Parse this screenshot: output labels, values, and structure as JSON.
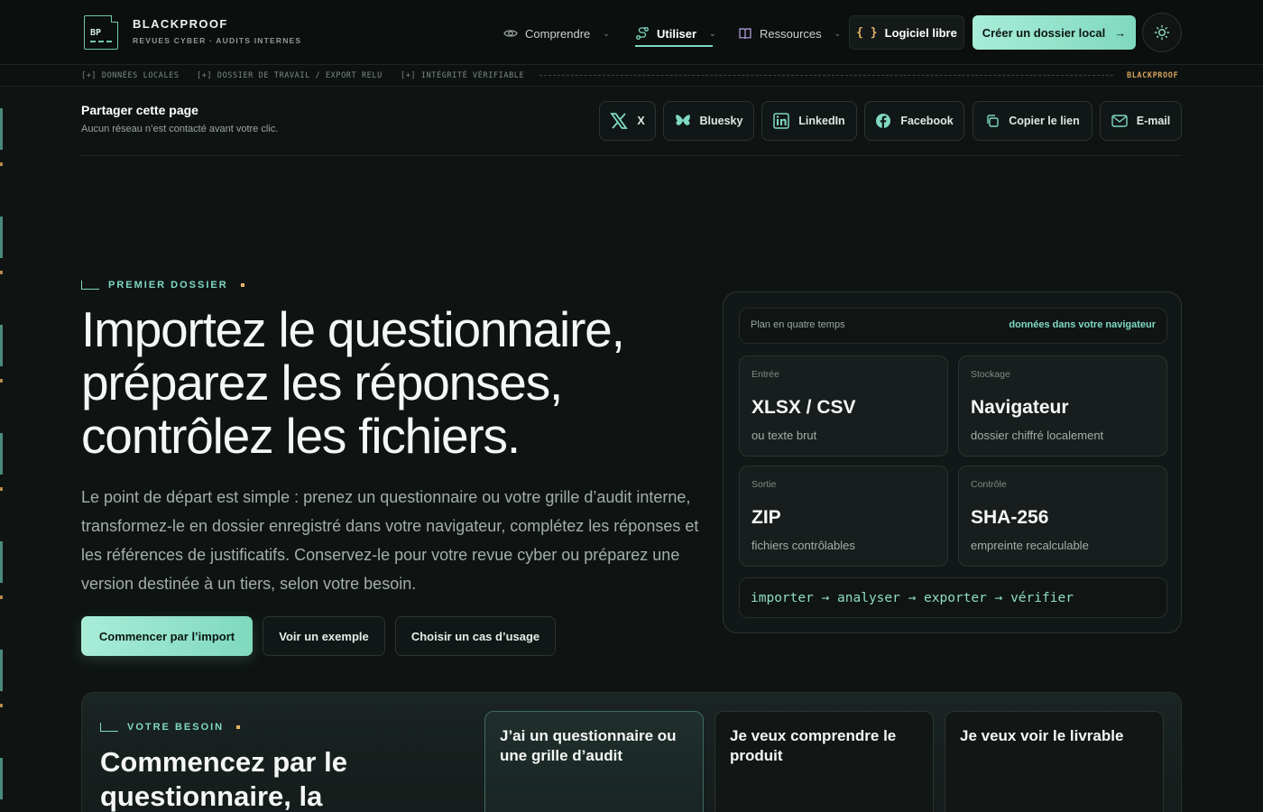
{
  "brand": {
    "logo_text": "BP",
    "name": "BLACKPROOF",
    "tagline": "REVUES CYBER · AUDITS INTERNES"
  },
  "nav": {
    "items": [
      {
        "label": "Comprendre",
        "icon": "eye-icon",
        "active": false
      },
      {
        "label": "Utiliser",
        "icon": "route-icon",
        "active": true
      },
      {
        "label": "Ressources",
        "icon": "book-icon",
        "active": false
      }
    ],
    "free_label": "Logiciel libre",
    "free_icon_text": "{ }",
    "create_label": "Créer un dossier local",
    "create_arrow": "→",
    "theme_icon": "sun-icon"
  },
  "strip": {
    "items": [
      "[+] DONNÉES LOCALES",
      "[+] DOSSIER DE TRAVAIL / EXPORT RELU",
      "[+] INTÉGRITÉ VÉRIFIABLE"
    ],
    "right": "BLACKPROOF"
  },
  "share": {
    "title": "Partager cette page",
    "subtitle": "Aucun réseau n’est contacté avant votre clic.",
    "buttons": [
      {
        "label": "X",
        "icon": "x-logo-icon"
      },
      {
        "label": "Bluesky",
        "icon": "bluesky-icon"
      },
      {
        "label": "LinkedIn",
        "icon": "linkedin-icon"
      },
      {
        "label": "Facebook",
        "icon": "facebook-icon"
      },
      {
        "label": "Copier le lien",
        "icon": "copy-icon"
      },
      {
        "label": "E-mail",
        "icon": "mail-icon"
      }
    ]
  },
  "hero": {
    "eyebrow": "PREMIER DOSSIER",
    "title": "Importez le questionnaire, préparez les réponses, contrôlez les fichiers.",
    "body": "Le point de départ est simple : prenez un questionnaire ou votre grille d’audit interne, transformez-le en dossier enregistré dans votre navigateur, complétez les réponses et les références de justificatifs. Conservez-le pour votre revue cyber ou préparez une version destinée à un tiers, selon votre besoin.",
    "cta_primary": "Commencer par l’import",
    "cta_example": "Voir un exemple",
    "cta_usecase": "Choisir un cas d’usage"
  },
  "plan": {
    "head_left": "Plan en quatre temps",
    "head_right": "données dans votre navigateur",
    "tiles": [
      {
        "label": "Entrée",
        "value": "XLSX / CSV",
        "desc": "ou texte brut"
      },
      {
        "label": "Stockage",
        "value": "Navigateur",
        "desc": "dossier chiffré localement"
      },
      {
        "label": "Sortie",
        "value": "ZIP",
        "desc": "fichiers contrôlables"
      },
      {
        "label": "Contrôle",
        "value": "SHA-256",
        "desc": "empreinte recalculable"
      }
    ],
    "flow": "importer → analyser → exporter → vérifier"
  },
  "needs": {
    "eyebrow": "VOTRE BESOIN",
    "title": "Commencez par le questionnaire, la",
    "cards": [
      {
        "title": "J’ai un questionnaire ou une grille d’audit",
        "active": true
      },
      {
        "title": "Je veux comprendre le produit",
        "active": false
      },
      {
        "title": "Je veux voir le livrable",
        "active": false
      }
    ]
  },
  "colors": {
    "accent": "#7fd9c2",
    "accent_warm": "#e6b366",
    "background": "#0f1413"
  }
}
